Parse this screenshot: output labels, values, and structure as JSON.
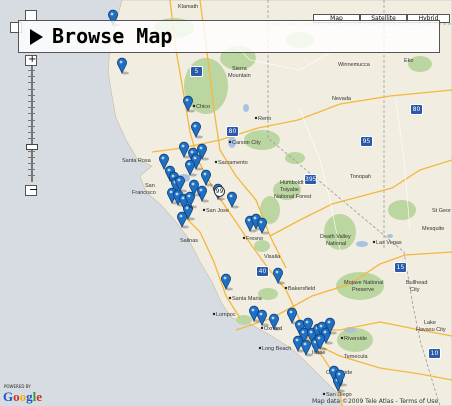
{
  "banner": {
    "title": "Browse Map"
  },
  "map_types": [
    "Map",
    "Satellite",
    "Hybrid"
  ],
  "top_labels": [
    "Klamath",
    "Eko"
  ],
  "place_labels": {
    "chico": "Chico",
    "reno": "Reno",
    "carson_city": "Carson City",
    "santa_rosa": "Santa Rosa",
    "sacramento": "Sacramento",
    "san_francisco_1": "San",
    "san_francisco_2": "Francisco",
    "san_jose": "San Jose",
    "salinas": "Salinas",
    "fresno": "Fresno",
    "visalia": "Visalia",
    "bakersfield": "Bakersfield",
    "santa_maria": "Santa Maria",
    "lompoc": "Lompoc",
    "oxnard": "Oxnard",
    "long_beach": "Long Beach",
    "riverside": "Riverside",
    "irvine": "Irvine",
    "temecula": "Temecula",
    "oceanside": "Oceanside",
    "san_diego": "San Diego",
    "nevada": "Nevada",
    "winnemucca": "Winnemucca",
    "humboldt_1": "Humboldt",
    "humboldt_2": "Toiyabe",
    "humboldt_3": "National Forest",
    "tonopah": "Tonopah",
    "death_valley_1": "Death Valley",
    "death_valley_2": "National",
    "las_vegas": "Las Vegas",
    "mojave_1": "Mojave National",
    "mojave_2": "Preserve",
    "bullhead_1": "Bullhead",
    "bullhead_2": "City",
    "lake_havasu_1": "Lake",
    "lake_havasu_2": "Havasu City",
    "mesquite": "Mesquite",
    "st_george": "St Geor",
    "sierra_1": "Sierra",
    "sierra_2": "Mountain"
  },
  "highways": [
    "80",
    "5",
    "99",
    "395",
    "15",
    "95",
    "40",
    "10",
    "80"
  ],
  "footer": {
    "powered_by": "POWERED BY",
    "logo": "Google",
    "copyright": "Map data ©2009 Tele Atlas - Terms of Use"
  },
  "marker_color": "#1f6fc2"
}
